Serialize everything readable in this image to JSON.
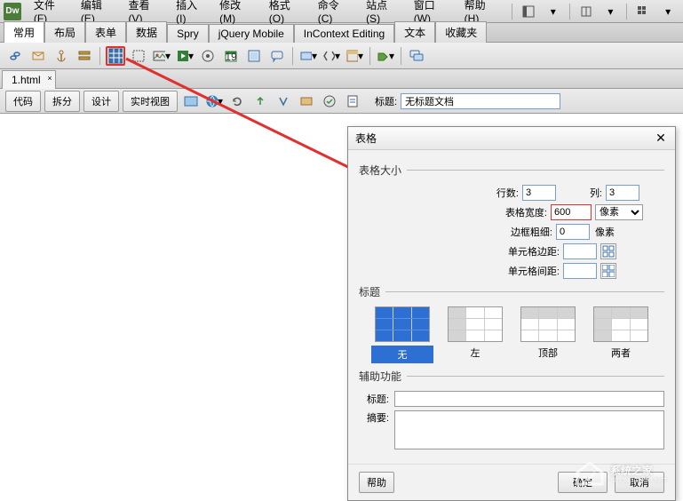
{
  "menubar": {
    "logo": "Dw",
    "items": [
      "文件(F)",
      "编辑(E)",
      "查看(V)",
      "插入(I)",
      "修改(M)",
      "格式(O)",
      "命令(C)",
      "站点(S)",
      "窗口(W)",
      "帮助(H)"
    ]
  },
  "tabbar": {
    "tabs": [
      "常用",
      "布局",
      "表单",
      "数据",
      "Spry",
      "jQuery Mobile",
      "InContext Editing",
      "文本",
      "收藏夹"
    ],
    "active": 0
  },
  "file": {
    "name": "1.html",
    "close": "×"
  },
  "viewbar": {
    "code": "代码",
    "split": "拆分",
    "design": "设计",
    "live": "实时视图",
    "title_label": "标题:",
    "title_value": "无标题文档"
  },
  "dialog": {
    "title": "表格",
    "close": "✕",
    "size_legend": "表格大小",
    "rows_label": "行数:",
    "rows": "3",
    "cols_label": "列:",
    "cols": "3",
    "width_label": "表格宽度:",
    "width": "600",
    "width_unit": "像素",
    "border_label": "边框粗细:",
    "border": "0",
    "border_unit": "像素",
    "cellpad_label": "单元格边距:",
    "cellpad": "",
    "cellspace_label": "单元格间距:",
    "cellspace": "",
    "header_legend": "标题",
    "header_opts": [
      "无",
      "左",
      "顶部",
      "两者"
    ],
    "aux_legend": "辅助功能",
    "caption_label": "标题:",
    "caption": "",
    "summary_label": "摘要:",
    "summary": "",
    "help": "帮助",
    "ok": "确定",
    "cancel": "取消"
  },
  "watermark": {
    "text": "系统之家",
    "sub": "XITONGZHIJIA.NET"
  }
}
